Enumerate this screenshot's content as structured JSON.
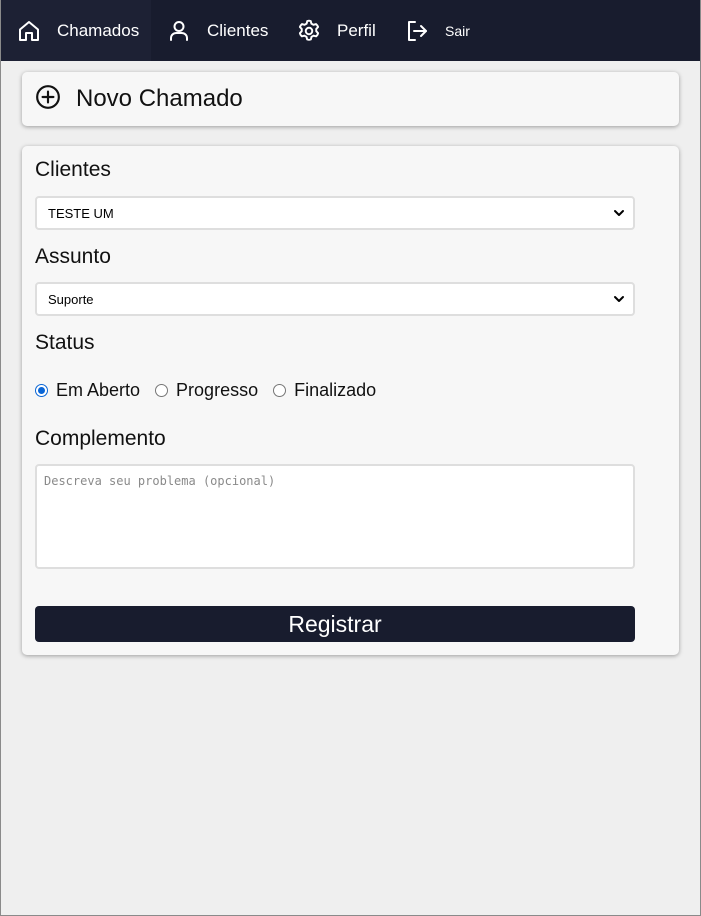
{
  "nav": {
    "items": [
      {
        "label": "Chamados",
        "icon": "home-icon"
      },
      {
        "label": "Clientes",
        "icon": "user-icon"
      },
      {
        "label": "Perfil",
        "icon": "gear-icon"
      },
      {
        "label": "Sair",
        "icon": "logout-icon"
      }
    ]
  },
  "page": {
    "title": "Novo Chamado",
    "title_icon": "plus-circle-icon"
  },
  "form": {
    "clientes": {
      "label": "Clientes",
      "selected": "TESTE UM"
    },
    "assunto": {
      "label": "Assunto",
      "selected": "Suporte"
    },
    "status": {
      "label": "Status",
      "options": [
        "Em Aberto",
        "Progresso",
        "Finalizado"
      ],
      "selected": "Em Aberto"
    },
    "complemento": {
      "label": "Complemento",
      "placeholder": "Descreva seu problema (opcional)"
    },
    "submit_label": "Registrar"
  },
  "colors": {
    "navbar": "#181c2e",
    "button": "#181c2e",
    "radio_accent": "#0a66d6",
    "background": "#efefef",
    "card": "#f7f7f7"
  }
}
